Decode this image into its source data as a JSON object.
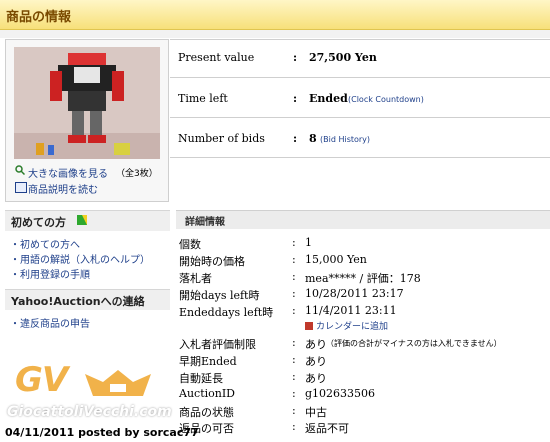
{
  "section_title": "商品の情報",
  "image_box": {
    "view_large": "大きな画像を見る",
    "count": "（全3枚）",
    "read_description": "商品説明を読む"
  },
  "summary": {
    "present_value_label": "Present value",
    "present_value": "27,500 Yen",
    "time_left_label": "Time left",
    "time_left": "Ended",
    "clock_link": "(Clock Countdown)",
    "bids_label": "Number of bids",
    "bids": "8",
    "bid_history_link": "(Bid History)"
  },
  "sidebar": {
    "first_time_heading": "初めての方",
    "links": [
      "・初めての方へ",
      "・用語の解説（入札のヘルプ）",
      "・利用登録の手順"
    ],
    "contact_heading": "Yahoo!Auctionへの連絡",
    "report_link": "・違反商品の申告"
  },
  "details": {
    "heading": "詳細情報",
    "rows": [
      {
        "k": "個数",
        "v": "1"
      },
      {
        "k": "開始時の価格",
        "v": "15,000 Yen"
      },
      {
        "k": "落札者",
        "v": "mea***** / 評価：178"
      },
      {
        "k": "開始days left時",
        "v": "10/28/2011 23:17"
      },
      {
        "k": "Endeddays left時",
        "v": "11/4/2011 23:11"
      },
      {
        "k": "入札者評価制限",
        "v": "あり",
        "note": "（評価の合計がマイナスの方は入札できません）"
      },
      {
        "k": "早期Ended",
        "v": "あり"
      },
      {
        "k": "自動延長",
        "v": "あり"
      },
      {
        "k": "AuctionID",
        "v": "g102633506"
      },
      {
        "k": "商品の状態",
        "v": "中古"
      },
      {
        "k": "返品の可否",
        "v": "返品不可"
      }
    ],
    "calendar_link": "カレンダーに追加"
  },
  "watermark": {
    "logo": "GV",
    "site": "GiocattoliVecchi.com"
  },
  "posted_by": "04/11/2011 posted by sorcac77"
}
